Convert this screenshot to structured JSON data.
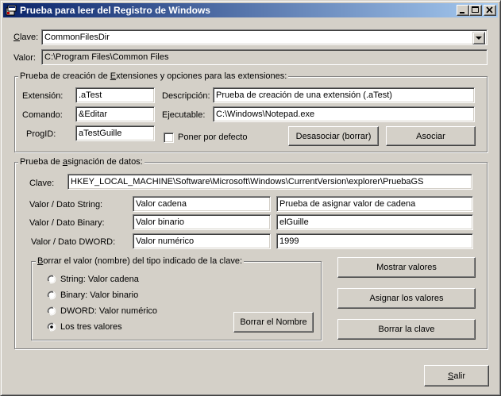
{
  "window": {
    "title": "Prueba para leer del Registro de Windows"
  },
  "top": {
    "clave_label_pre": "",
    "clave_label_u": "C",
    "clave_label_post": "lave:",
    "clave_value": "CommonFilesDir",
    "valor_label": "Valor:",
    "valor_value": "C:\\Program Files\\Common Files"
  },
  "extensions": {
    "title_pre": "Prueba de creación de ",
    "title_u": "E",
    "title_post": "xtensiones y opciones para las extensiones:",
    "extension_label": "Extensión:",
    "extension_value": ".aTest",
    "descripcion_label": "Descripción:",
    "descripcion_value": "Prueba de creación de una extensión (.aTest)",
    "comando_label": "Comando:",
    "comando_value": "&Editar",
    "ejecutable_label": "Ejecutable:",
    "ejecutable_value": "C:\\Windows\\Notepad.exe",
    "progid_label": "ProgID:",
    "progid_value": "aTestGuille",
    "default_checkbox_label": "Poner por defecto",
    "desasociar_button": "Desasociar (borrar)",
    "asociar_button": "Asociar"
  },
  "data": {
    "title_pre": "Prueba de ",
    "title_u": "a",
    "title_post": "signación de datos:",
    "clave_label": "Clave:",
    "clave_value": "HKEY_LOCAL_MACHINE\\Software\\Microsoft\\Windows\\CurrentVersion\\explorer\\PruebaGS",
    "string_label": "Valor / Dato String:",
    "string_name": "Valor cadena",
    "string_data": "Prueba de asignar valor de cadena",
    "binary_label": "Valor / Dato Binary:",
    "binary_name": "Valor binario",
    "binary_data": "elGuille",
    "dword_label": "Valor / Dato DWORD:",
    "dword_name": "Valor numérico",
    "dword_data": "1999",
    "mostrar_button": "Mostrar valores",
    "asignar_button": "Asignar los valores",
    "borrar_clave_button": "Borrar la clave"
  },
  "delete": {
    "title_pre": "",
    "title_u": "B",
    "title_post": "orrar el valor (nombre) del tipo indicado de la clave:",
    "options": [
      {
        "label": "String: Valor cadena",
        "selected": false
      },
      {
        "label": "Binary: Valor binario",
        "selected": false
      },
      {
        "label": "DWORD: Valor numérico",
        "selected": false
      },
      {
        "label": "Los tres valores",
        "selected": true
      }
    ],
    "borrar_nombre_button": "Borrar el Nombre"
  },
  "footer": {
    "salir_pre": "",
    "salir_u": "S",
    "salir_post": "alir"
  }
}
